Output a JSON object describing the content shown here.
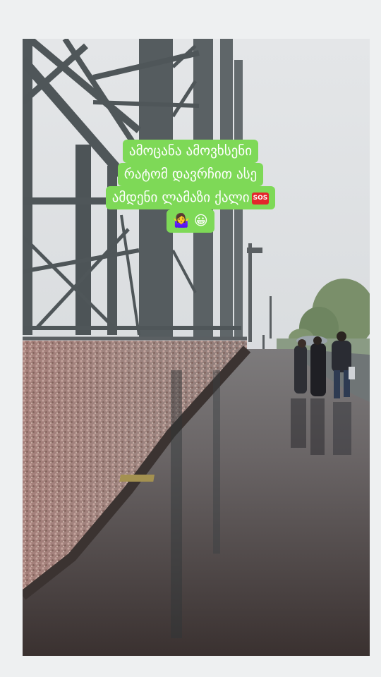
{
  "caption": {
    "line1": "ამოცანა ამოვხსენი",
    "line2": "რატომ დავრჩით ასე",
    "line3": "ამდენი ლამაზი ქალი",
    "sos_badge": "SOS",
    "line4_emojis": "🤷‍♀️ 😀"
  },
  "photo": {
    "subject": "love-lock bridge in rain",
    "colors": {
      "sky": "#d7dadd",
      "steel": "#4e5558",
      "walkway": "#4f4745",
      "caption_bg": "#7ed957"
    }
  }
}
